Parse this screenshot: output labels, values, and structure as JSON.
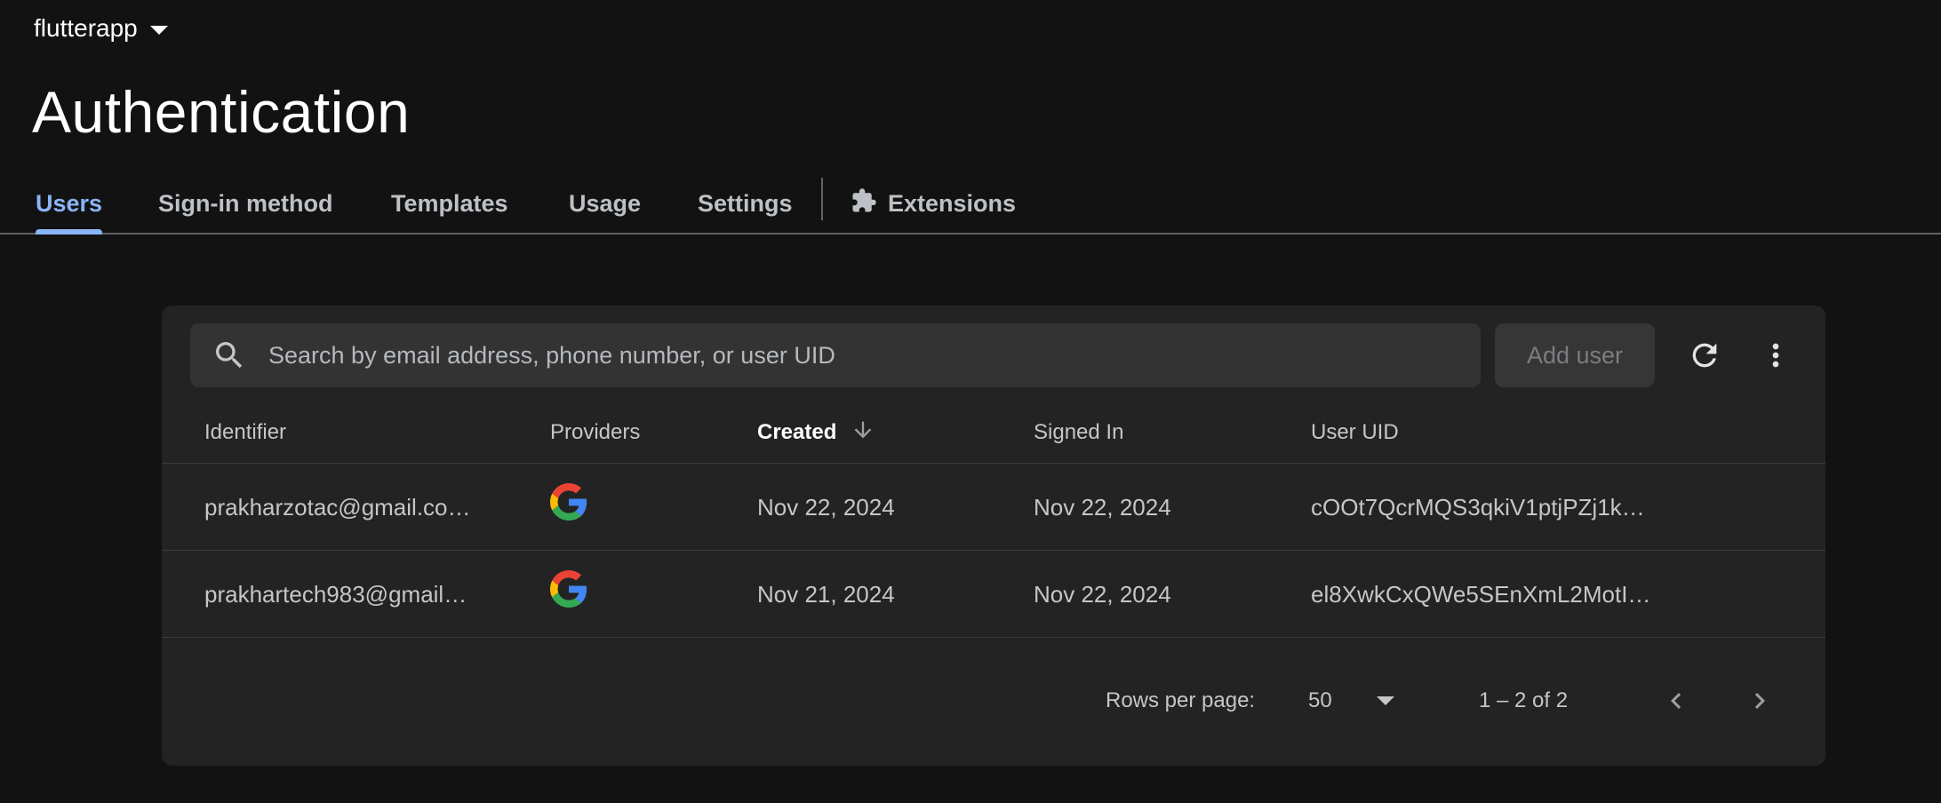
{
  "project": {
    "name": "flutterapp"
  },
  "page": {
    "title": "Authentication"
  },
  "tabs": [
    {
      "label": "Users",
      "active": true
    },
    {
      "label": "Sign-in method",
      "active": false
    },
    {
      "label": "Templates",
      "active": false
    },
    {
      "label": "Usage",
      "active": false
    },
    {
      "label": "Settings",
      "active": false
    },
    {
      "label": "Extensions",
      "active": false,
      "icon": "extension-puzzle-icon"
    }
  ],
  "toolbar": {
    "search_placeholder": "Search by email address, phone number, or user UID",
    "search_value": "",
    "add_user_label": "Add user",
    "refresh_icon": "refresh-icon",
    "more_icon": "more-vert-icon"
  },
  "table": {
    "columns": [
      "Identifier",
      "Providers",
      "Created",
      "Signed In",
      "User UID"
    ],
    "sorted_column": "Created",
    "sort_direction": "descending",
    "rows": [
      {
        "identifier": "prakharzotac@gmail.co…",
        "provider": "google",
        "created": "Nov 22, 2024",
        "signed_in": "Nov 22, 2024",
        "uid": "cOOt7QcrMQS3qkiV1ptjPZj1k…"
      },
      {
        "identifier": "prakhartech983@gmail…",
        "provider": "google",
        "created": "Nov 21, 2024",
        "signed_in": "Nov 22, 2024",
        "uid": "el8XwkCxQWe5SEnXmL2MotI…"
      }
    ]
  },
  "pagination": {
    "rows_per_page_label": "Rows per page:",
    "rows_per_page_value": "50",
    "range_text": "1 – 2 of 2"
  },
  "colors": {
    "background": "#121212",
    "card": "#232323",
    "accent": "#8ab4f8",
    "google_blue": "#4285F4",
    "google_red": "#EA4335",
    "google_yellow": "#FBBC05",
    "google_green": "#34A853"
  }
}
